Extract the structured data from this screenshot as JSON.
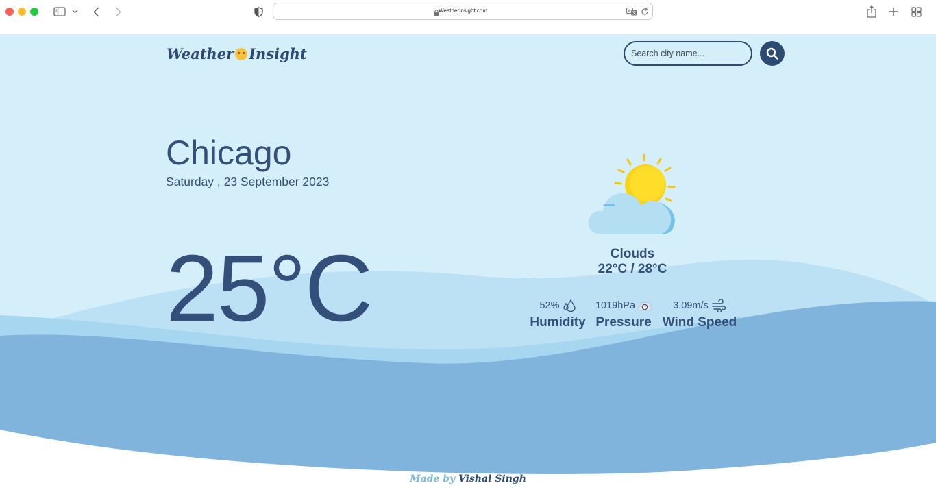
{
  "browser": {
    "url": "WeatherInsight.com",
    "icons": [
      "sidebar-icon",
      "chevron-down-icon",
      "back-icon",
      "forward-icon",
      "shield-icon",
      "lock-icon",
      "translate-icon",
      "reload-icon",
      "share-icon",
      "new-tab-icon",
      "tab-overview-icon"
    ]
  },
  "header": {
    "logo_left": "Weather",
    "logo_right": "Insight",
    "search_placeholder": "Search city name..."
  },
  "current": {
    "city": "Chicago",
    "date": "Saturday , 23 September 2023",
    "temperature": "25°C",
    "condition": "Clouds",
    "range": "22°C / 28°C"
  },
  "stats": {
    "humidity": {
      "value": "52%",
      "label": "Humidity"
    },
    "pressure": {
      "value": "1019hPa",
      "label": "Pressure"
    },
    "wind": {
      "value": "3.09m/s",
      "label": "Wind Speed"
    }
  },
  "footer": {
    "made_by": "Made by",
    "author": "Vishal Singh"
  },
  "colors": {
    "navy": "#2d4a73",
    "sky_bg": "#d5effa",
    "wave_light": "#a6d6f0",
    "wave_dark": "#80b4dc"
  }
}
